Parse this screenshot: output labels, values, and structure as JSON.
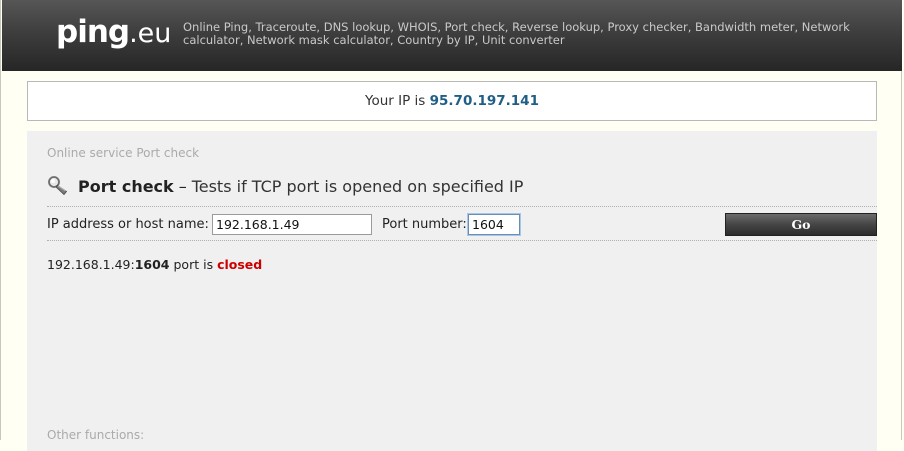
{
  "header": {
    "logo_main": "ping",
    "logo_tld": ".eu",
    "tagline": "Online Ping, Traceroute, DNS lookup, WHOIS, Port check, Reverse lookup, Proxy checker, Bandwidth meter, Network calculator, Network mask calculator, Country by IP, Unit converter"
  },
  "ip_bar": {
    "label": "Your IP is",
    "value": "95.70.197.141"
  },
  "main": {
    "breadcrumb": "Online service Port check",
    "title": "Port check",
    "dash": "–",
    "description": "Tests if TCP port is opened on specified IP",
    "form": {
      "host_label": "IP address or host name:",
      "host_value": "192.168.1.49",
      "port_label": "Port number:",
      "port_value": "1604",
      "go_label": "Go"
    },
    "result": {
      "host": "192.168.1.49:",
      "port": "1604",
      "middle": "port is",
      "status": "closed",
      "status_color": "#cc0000"
    },
    "other_functions": "Other functions:"
  },
  "icons": {
    "title_icon": "magnifier-tool-icon"
  },
  "colors": {
    "ip_value": "#1f5f86",
    "header_bg": "#3e3e3e",
    "panel_bg": "#f0f0f0"
  }
}
